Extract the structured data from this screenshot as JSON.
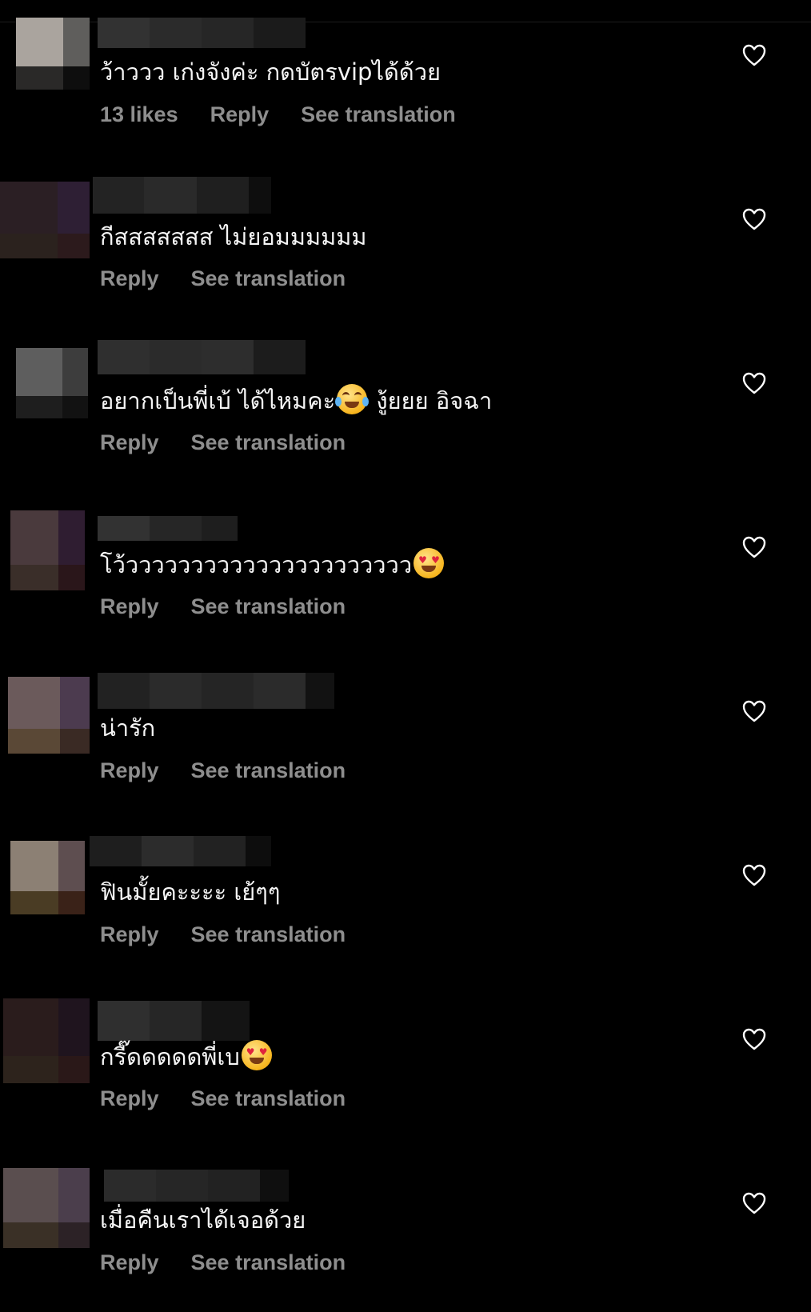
{
  "colors": {
    "background": "#000000",
    "text": "#f5f5f5",
    "secondary": "#8e8e8e"
  },
  "comments": [
    {
      "text": "ว้าววว เก่งจังค่ะ กดบัตรvipได้ด้วย",
      "likes": "13 likes",
      "reply": "Reply",
      "translate": "See translation",
      "icon": "heart-outline-icon"
    },
    {
      "text": "กีสสสสสสส ไม่ยอมมมมมม",
      "reply": "Reply",
      "translate": "See translation",
      "icon": "heart-outline-icon"
    },
    {
      "text_a": "อยากเป็นพี่เบ้ ได้ไหมคะ",
      "emoji": "face-with-tears-of-joy",
      "text_b": " งู้ยยย อิจฉา",
      "reply": "Reply",
      "translate": "See translation",
      "icon": "heart-outline-icon"
    },
    {
      "text": "โว้วววววววววววววววววววววว",
      "emoji": "smiling-face-with-heart-eyes",
      "reply": "Reply",
      "translate": "See translation",
      "icon": "heart-outline-icon"
    },
    {
      "text": "น่ารัก",
      "reply": "Reply",
      "translate": "See translation",
      "icon": "heart-outline-icon"
    },
    {
      "text": "ฟินมั้ยคะะะะ เย้ๆๆ",
      "reply": "Reply",
      "translate": "See translation",
      "icon": "heart-outline-icon"
    },
    {
      "text": "กรี๊ดดดดดพี่เบ",
      "emoji": "smiling-face-with-heart-eyes",
      "reply": "Reply",
      "translate": "See translation",
      "icon": "heart-outline-icon"
    },
    {
      "text": "เมื่อคืนเราได้เจอด้วย",
      "reply": "Reply",
      "translate": "See translation",
      "icon": "heart-outline-icon"
    }
  ]
}
